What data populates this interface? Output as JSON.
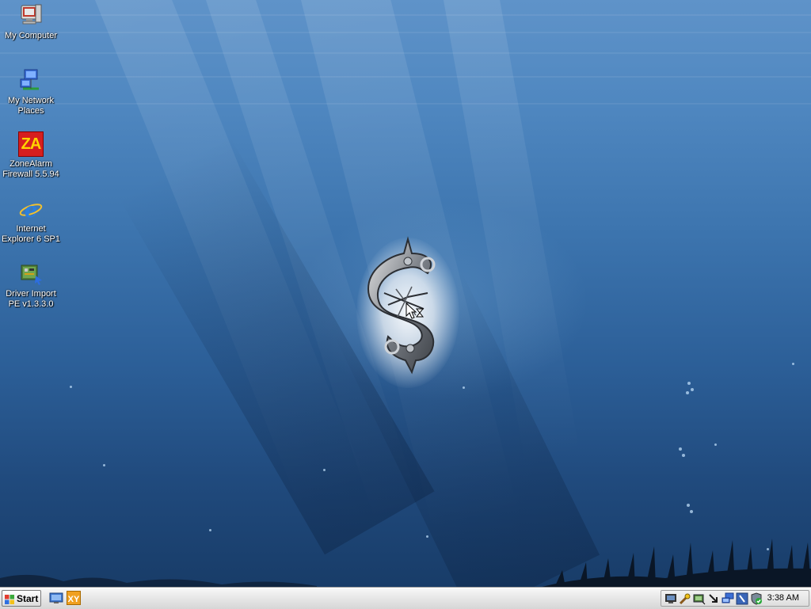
{
  "desktop": {
    "icons": [
      {
        "name": "my-computer",
        "label": "My Computer"
      },
      {
        "name": "my-network-places",
        "label": "My Network\nPlaces"
      },
      {
        "name": "zonealarm",
        "label": "ZoneAlarm\nFirewall 5.5.94",
        "logo_text": "ZA"
      },
      {
        "name": "internet-explorer",
        "label": "Internet\nExplorer 6 SP1"
      },
      {
        "name": "driver-import",
        "label": "Driver Import\nPE v1.3.3.0"
      }
    ]
  },
  "taskbar": {
    "start_label": "Start",
    "quick_launch": [
      "show-desktop-icon",
      "xy-app-icon"
    ],
    "quick_launch_xy_text": "XY",
    "tray_icons": [
      "monitor-icon",
      "tools-icon",
      "network-card-icon",
      "arrow-down-icon",
      "network-computers-icon",
      "security-shield-icon",
      "checkmark-shield-icon"
    ],
    "clock": "3:38 AM"
  },
  "colors": {
    "desktop_top": "#5f93c9",
    "desktop_bottom": "#183c68",
    "taskbar": "#e6e6e6"
  }
}
